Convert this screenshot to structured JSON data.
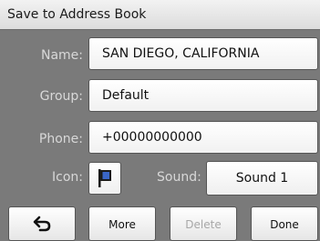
{
  "dialog": {
    "title": "Save to Address Book"
  },
  "form": {
    "name_label": "Name:",
    "name_value": "SAN DIEGO, CALIFORNIA",
    "group_label": "Group:",
    "group_value": "Default",
    "phone_label": "Phone:",
    "phone_value": "+00000000000",
    "icon_label": "Icon:",
    "icon_name": "flag-icon",
    "icon_color": "#3a66c7",
    "sound_label": "Sound:",
    "sound_value": "Sound 1"
  },
  "buttons": {
    "back_icon": "back-arrow-icon",
    "more": "More",
    "delete": "Delete",
    "done": "Done"
  }
}
